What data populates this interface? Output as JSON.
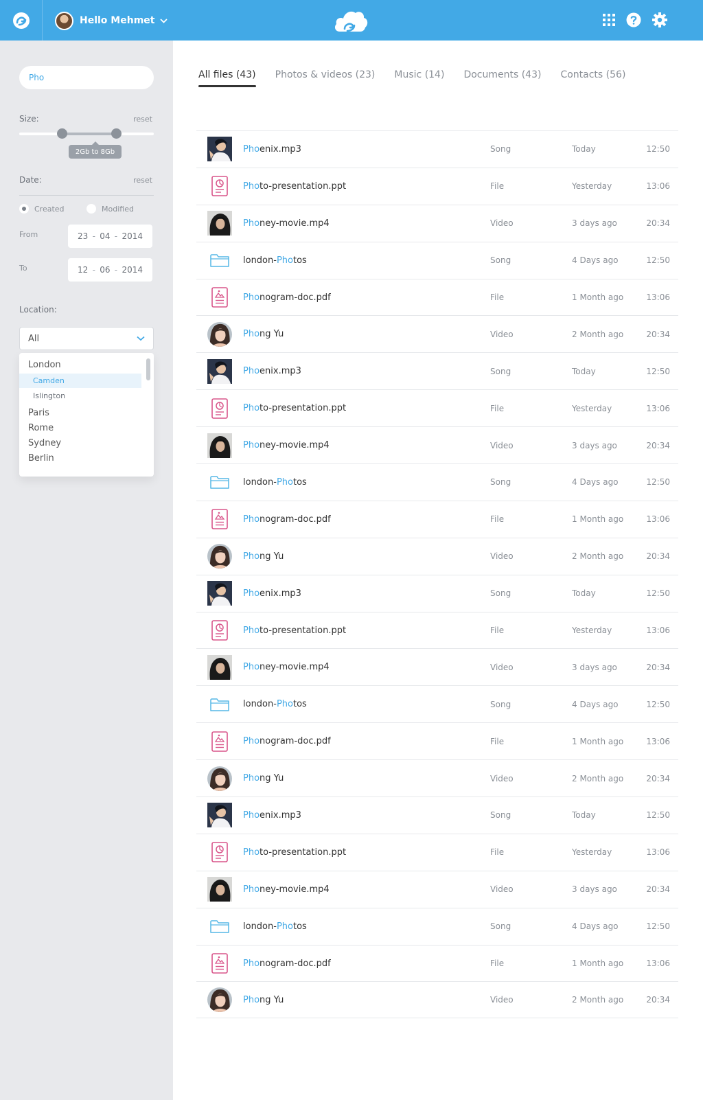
{
  "header": {
    "greeting": "Hello Mehmet",
    "brand_color": "#42a9e6"
  },
  "sidebar": {
    "search_value": "Pho",
    "size_label": "Size:",
    "size_reset": "reset",
    "size_range_text": "2Gb to 8Gb",
    "size_range_fraction": [
      0.32,
      0.72
    ],
    "date_label": "Date:",
    "date_reset": "reset",
    "radio_created": "Created",
    "radio_modified": "Modified",
    "radio_selected": "Created",
    "from_label": "From",
    "from_day": "23",
    "from_month": "04",
    "from_year": "2014",
    "to_label": "To",
    "to_day": "12",
    "to_month": "06",
    "to_year": "2014",
    "location_label": "Location:",
    "location_value": "All",
    "location_options": [
      {
        "label": "London",
        "level": "city"
      },
      {
        "label": "Camden",
        "level": "district",
        "active": true
      },
      {
        "label": "Islington",
        "level": "district"
      },
      {
        "label": "Paris",
        "level": "city"
      },
      {
        "label": "Rome",
        "level": "city"
      },
      {
        "label": "Sydney",
        "level": "city"
      },
      {
        "label": "Berlin",
        "level": "city"
      }
    ]
  },
  "tabs": [
    {
      "label": "All files (43)",
      "active": true
    },
    {
      "label": "Photos & videos (23)"
    },
    {
      "label": "Music (14)"
    },
    {
      "label": "Documents (43)"
    },
    {
      "label": "Contacts (56)"
    }
  ],
  "files": [
    {
      "icon": "portrait-photo-thumbnail",
      "match": "Pho",
      "rest": "enix.mp3",
      "match_first": true,
      "type": "Song",
      "date": "Today",
      "time": "12:50"
    },
    {
      "icon": "presentation-file-icon",
      "match": "Pho",
      "rest": "to-presentation.ppt",
      "match_first": true,
      "type": "File",
      "date": "Yesterday",
      "time": "13:06"
    },
    {
      "icon": "hooded-photo-thumbnail",
      "match": "Pho",
      "rest": "ney-movie.mp4",
      "match_first": true,
      "type": "Video",
      "date": "3 days ago",
      "time": "20:34"
    },
    {
      "icon": "folder-icon",
      "pre": "london-",
      "match": "Pho",
      "rest": "tos",
      "match_first": false,
      "type": "Song",
      "date": "4 Days ago",
      "time": "12:50"
    },
    {
      "icon": "document-file-icon",
      "match": "Pho",
      "rest": "nogram-doc.pdf",
      "match_first": true,
      "type": "File",
      "date": "1 Month ago",
      "time": "13:06"
    },
    {
      "icon": "contact-avatar",
      "match": "Pho",
      "rest": "ng Yu",
      "match_first": true,
      "type": "Video",
      "date": "2 Month ago",
      "time": "20:34"
    },
    {
      "icon": "portrait-photo-thumbnail",
      "match": "Pho",
      "rest": "enix.mp3",
      "match_first": true,
      "type": "Song",
      "date": "Today",
      "time": "12:50"
    },
    {
      "icon": "presentation-file-icon",
      "match": "Pho",
      "rest": "to-presentation.ppt",
      "match_first": true,
      "type": "File",
      "date": "Yesterday",
      "time": "13:06"
    },
    {
      "icon": "hooded-photo-thumbnail",
      "match": "Pho",
      "rest": "ney-movie.mp4",
      "match_first": true,
      "type": "Video",
      "date": "3 days ago",
      "time": "20:34"
    },
    {
      "icon": "folder-icon",
      "pre": "london-",
      "match": "Pho",
      "rest": "tos",
      "match_first": false,
      "type": "Song",
      "date": "4 Days ago",
      "time": "12:50"
    },
    {
      "icon": "document-file-icon",
      "match": "Pho",
      "rest": "nogram-doc.pdf",
      "match_first": true,
      "type": "File",
      "date": "1 Month ago",
      "time": "13:06"
    },
    {
      "icon": "contact-avatar",
      "match": "Pho",
      "rest": "ng Yu",
      "match_first": true,
      "type": "Video",
      "date": "2 Month ago",
      "time": "20:34"
    },
    {
      "icon": "portrait-photo-thumbnail",
      "match": "Pho",
      "rest": "enix.mp3",
      "match_first": true,
      "type": "Song",
      "date": "Today",
      "time": "12:50"
    },
    {
      "icon": "presentation-file-icon",
      "match": "Pho",
      "rest": "to-presentation.ppt",
      "match_first": true,
      "type": "File",
      "date": "Yesterday",
      "time": "13:06"
    },
    {
      "icon": "hooded-photo-thumbnail",
      "match": "Pho",
      "rest": "ney-movie.mp4",
      "match_first": true,
      "type": "Video",
      "date": "3 days ago",
      "time": "20:34"
    },
    {
      "icon": "folder-icon",
      "pre": "london-",
      "match": "Pho",
      "rest": "tos",
      "match_first": false,
      "type": "Song",
      "date": "4 Days ago",
      "time": "12:50"
    },
    {
      "icon": "document-file-icon",
      "match": "Pho",
      "rest": "nogram-doc.pdf",
      "match_first": true,
      "type": "File",
      "date": "1 Month ago",
      "time": "13:06"
    },
    {
      "icon": "contact-avatar",
      "match": "Pho",
      "rest": "ng Yu",
      "match_first": true,
      "type": "Video",
      "date": "2 Month ago",
      "time": "20:34"
    },
    {
      "icon": "portrait-photo-thumbnail",
      "match": "Pho",
      "rest": "enix.mp3",
      "match_first": true,
      "type": "Song",
      "date": "Today",
      "time": "12:50"
    },
    {
      "icon": "presentation-file-icon",
      "match": "Pho",
      "rest": "to-presentation.ppt",
      "match_first": true,
      "type": "File",
      "date": "Yesterday",
      "time": "13:06"
    },
    {
      "icon": "hooded-photo-thumbnail",
      "match": "Pho",
      "rest": "ney-movie.mp4",
      "match_first": true,
      "type": "Video",
      "date": "3 days ago",
      "time": "20:34"
    },
    {
      "icon": "folder-icon",
      "pre": "london-",
      "match": "Pho",
      "rest": "tos",
      "match_first": false,
      "type": "Song",
      "date": "4 Days ago",
      "time": "12:50"
    },
    {
      "icon": "document-file-icon",
      "match": "Pho",
      "rest": "nogram-doc.pdf",
      "match_first": true,
      "type": "File",
      "date": "1 Month ago",
      "time": "13:06"
    },
    {
      "icon": "contact-avatar",
      "match": "Pho",
      "rest": "ng Yu",
      "match_first": true,
      "type": "Video",
      "date": "2 Month ago",
      "time": "20:34"
    }
  ]
}
